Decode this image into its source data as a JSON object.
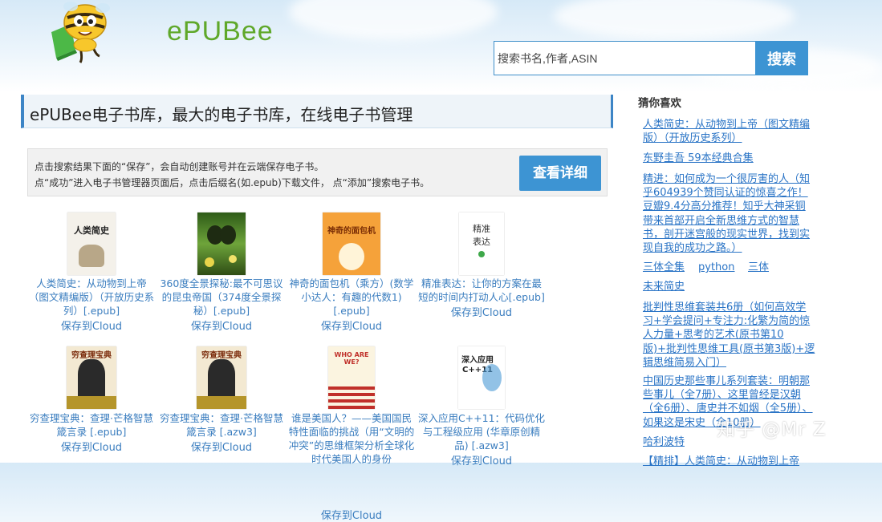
{
  "brand": {
    "name": "ePUBee"
  },
  "search": {
    "placeholder": "搜索书名,作者,ASIN",
    "button_label": "搜索"
  },
  "page_title": "ePUBee电子书库，最大的电子书库，在线电子书管理",
  "notice": {
    "line1": "点击搜索结果下面的“保存”，会自动创建账号并在云端保存电子书。",
    "line2": "点“成功”进入电子书管理器页面后，点击后缀名(如.epub)下载文件， 点“添加”搜索电子书。",
    "button_label": "查看详细"
  },
  "books": [
    {
      "title": "人类简史：从动物到上帝（图文精编版）（开放历史系列）[.epub]",
      "save": "保存到Cloud",
      "cover_text": "人类简史"
    },
    {
      "title": "360度全景探秘:最不可思议的昆虫帝国（374度全景探秘）[.epub]",
      "save": "保存到Cloud",
      "cover_text": ""
    },
    {
      "title": "神奇的面包机（乘方）(数学小达人：有趣的代数1) [.epub]",
      "save": "保存到Cloud",
      "cover_text": "神奇的面包机"
    },
    {
      "title": "精准表达：让你的方案在最短的时间内打动人心[.epub]",
      "save": "保存到Cloud",
      "cover_text": "精准表达"
    },
    {
      "title": "穷查理宝典：查理·芒格智慧箴言录 [.epub]",
      "save": "保存到Cloud",
      "cover_text": "穷查理宝典"
    },
    {
      "title": "穷查理宝典：查理·芒格智慧箴言录 [.azw3]",
      "save": "保存到Cloud",
      "cover_text": "穷查理宝典"
    },
    {
      "title": "谁是美国人？——美国国民特性面临的挑战（用“文明的冲突”的思维框架分析全球化时代美国人的身份",
      "save": "保存到Cloud",
      "cover_text": "WHO ARE WE?"
    },
    {
      "title": "深入应用C++11：代码优化与工程级应用 (华章原创精品) [.azw3]",
      "save": "保存到Cloud",
      "cover_text": "深入应用 C++11"
    }
  ],
  "sidebar": {
    "heading": "猜你喜欢",
    "links": [
      "人类简史：从动物到上帝（图文精编版）（开放历史系列）",
      "东野圭吾 59本经典合集",
      "精进：如何成为一个很厉害的人（知乎604939个赞同认证的惊喜之作！豆瓣9.4分高分推荐！知乎大神采铜带来首部开启全新思维方式的智慧书，剖开迷宫般的现实世界，找到实现自我的成功之路。）",
      "三体全集",
      "python",
      "三体",
      "未来简史",
      "批判性思维套装共6册（如何高效学习+学会提问+专注力:化繁为简的惊人力量+思考的艺术(原书第10版)+批判性思维工具(原书第3版)+逻辑思维简易入门）",
      "中国历史那些事儿系列套装：明朝那些事儿（全7册）、这里曾经是汉朝（全6册）、唐史并不如烟（全5册）、如果这是宋史（全10册）",
      "哈利波特",
      "【精排】人类简史：从动物到上帝"
    ]
  },
  "watermark": "知乎 @Mr Z"
}
